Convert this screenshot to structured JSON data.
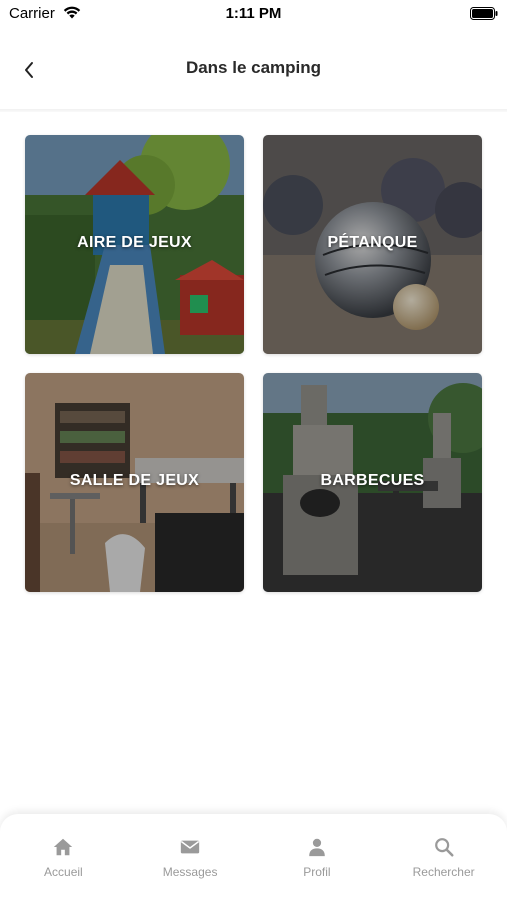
{
  "status_bar": {
    "carrier": "Carrier",
    "time": "1:11 PM"
  },
  "header": {
    "title": "Dans le camping",
    "back_icon": "chevron-left-icon"
  },
  "tiles": [
    {
      "label": "AIRE DE JEUX"
    },
    {
      "label": "PÉTANQUE"
    },
    {
      "label": "SALLE DE JEUX"
    },
    {
      "label": "BARBECUES"
    }
  ],
  "tab_bar": {
    "items": [
      {
        "label": "Accueil",
        "icon": "home-icon"
      },
      {
        "label": "Messages",
        "icon": "envelope-icon"
      },
      {
        "label": "Profil",
        "icon": "user-icon"
      },
      {
        "label": "Rechercher",
        "icon": "search-icon"
      }
    ],
    "icon_color": "#9a9a9a"
  }
}
